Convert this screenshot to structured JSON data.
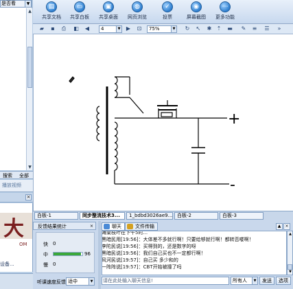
{
  "left_panel": {
    "dropdown_value": "是否看",
    "tabs": [
      "搜索",
      "全部"
    ],
    "video_label": "播放视频",
    "logo_letter": "大",
    "logo_sub": "OM",
    "logo_link": "设备..."
  },
  "toolbar": {
    "buttons": [
      {
        "label": "共享文档",
        "icon": "share-doc-icon"
      },
      {
        "label": "共享白板",
        "icon": "whiteboard-icon"
      },
      {
        "label": "共享桌面",
        "icon": "share-desktop-icon"
      },
      {
        "label": "网页浏览",
        "icon": "web-browse-icon"
      },
      {
        "label": "投票",
        "icon": "vote-icon"
      },
      {
        "label": "屏幕截图",
        "icon": "screenshot-icon"
      },
      {
        "label": "更多功能",
        "icon": "more-icon"
      }
    ]
  },
  "toolbar2": {
    "page_value": "4",
    "zoom_value": "75%"
  },
  "canvas": {
    "plus_label": "+",
    "minus_label": "-"
  },
  "whiteboard_tabs": [
    "白板-1",
    "同步整流技术3...",
    "1_bdbd3026ae9...",
    "白板-2",
    "白板-3"
  ],
  "stats": {
    "title": "反馈结果统计",
    "rows": [
      {
        "label": "快",
        "value": "0"
      },
      {
        "label": "中",
        "value": ""
      },
      {
        "label": "慢",
        "value": "0"
      }
    ],
    "medium_percent": 96,
    "medium_number": "96"
  },
  "feedback": {
    "label": "听课速度反馈",
    "selected": "适中"
  },
  "chat": {
    "tabs": [
      "聊天",
      "文件传输"
    ],
    "messages": [
      "海棠枝叶在下午5时...",
      "黑暗民用[19:56]：大体差不多就行啊！只要给够就行啊！都转否喽啊！",
      "李陀民说[19:56]：买得到的，还是数字的呀",
      "黑暗民说[19:56]：我们自己买也不一定都行啊！",
      "风河民说[19:57]：自己买 多少和的",
      "一阵阵说[19:57]：CBT开始被撞了吗"
    ],
    "input_placeholder": "请在此处输入聊天信息!",
    "recipient": "所有人",
    "send_label": "发送",
    "options_label": "选项"
  }
}
